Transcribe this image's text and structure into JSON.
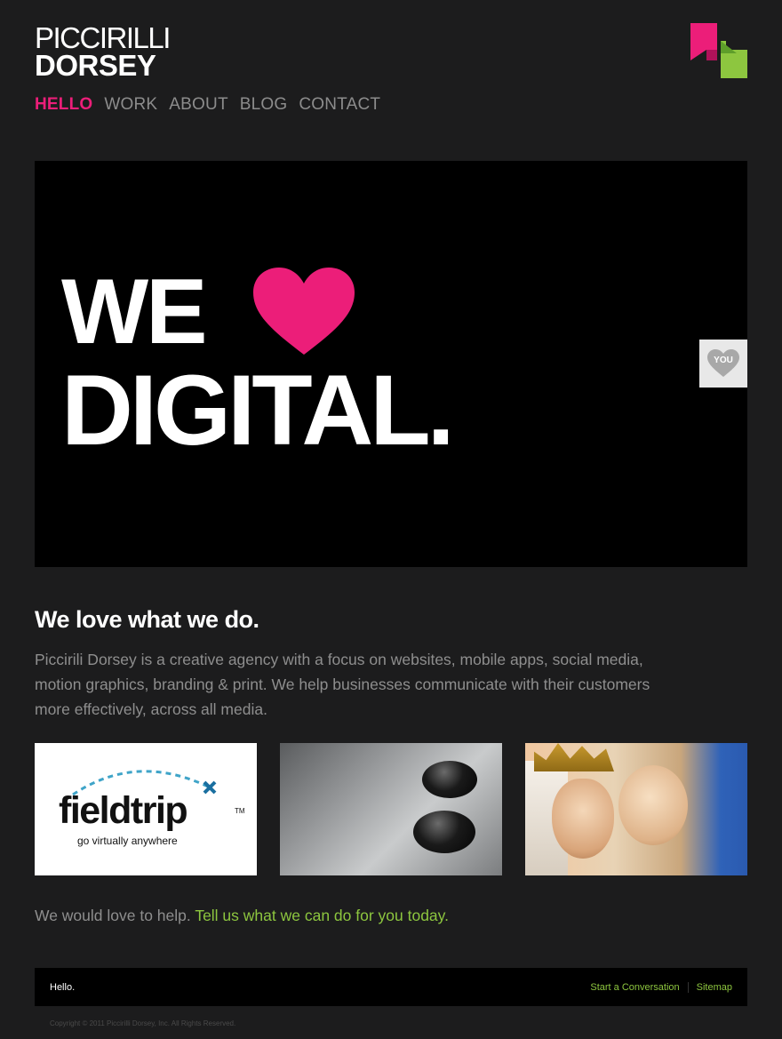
{
  "brand": {
    "line1": "PICCIRILLI",
    "line2": "DORSEY",
    "colors": {
      "pink": "#ec1e79",
      "green": "#8dc63f",
      "background": "#1c1c1d"
    }
  },
  "nav": {
    "items": [
      {
        "label": "HELLO",
        "active": true
      },
      {
        "label": "WORK",
        "active": false
      },
      {
        "label": "ABOUT",
        "active": false
      },
      {
        "label": "BLOG",
        "active": false
      },
      {
        "label": "CONTACT",
        "active": false
      }
    ]
  },
  "hero": {
    "line1": "WE",
    "line2": "DIGITAL.",
    "you_tab_label": "YOU"
  },
  "intro": {
    "title": "We love what we do.",
    "body": "Piccirili Dorsey is a creative agency with a focus on websites, mobile apps, social media, motion graphics, branding & print. We help businesses communicate with their customers more effectively, across all media."
  },
  "thumbnails": {
    "fieldtrip": {
      "word": "fieldtrip",
      "tm": "TM",
      "tagline": "go virtually anywhere"
    }
  },
  "cta": {
    "text": "We would love to help. ",
    "link": "Tell us what we can do for you today."
  },
  "footer": {
    "hello": "Hello.",
    "links": [
      "Start a Conversation",
      "Sitemap"
    ],
    "copyright": "Copyright © 2011 Piccirilli Dorsey, Inc. All Rights Reserved."
  }
}
